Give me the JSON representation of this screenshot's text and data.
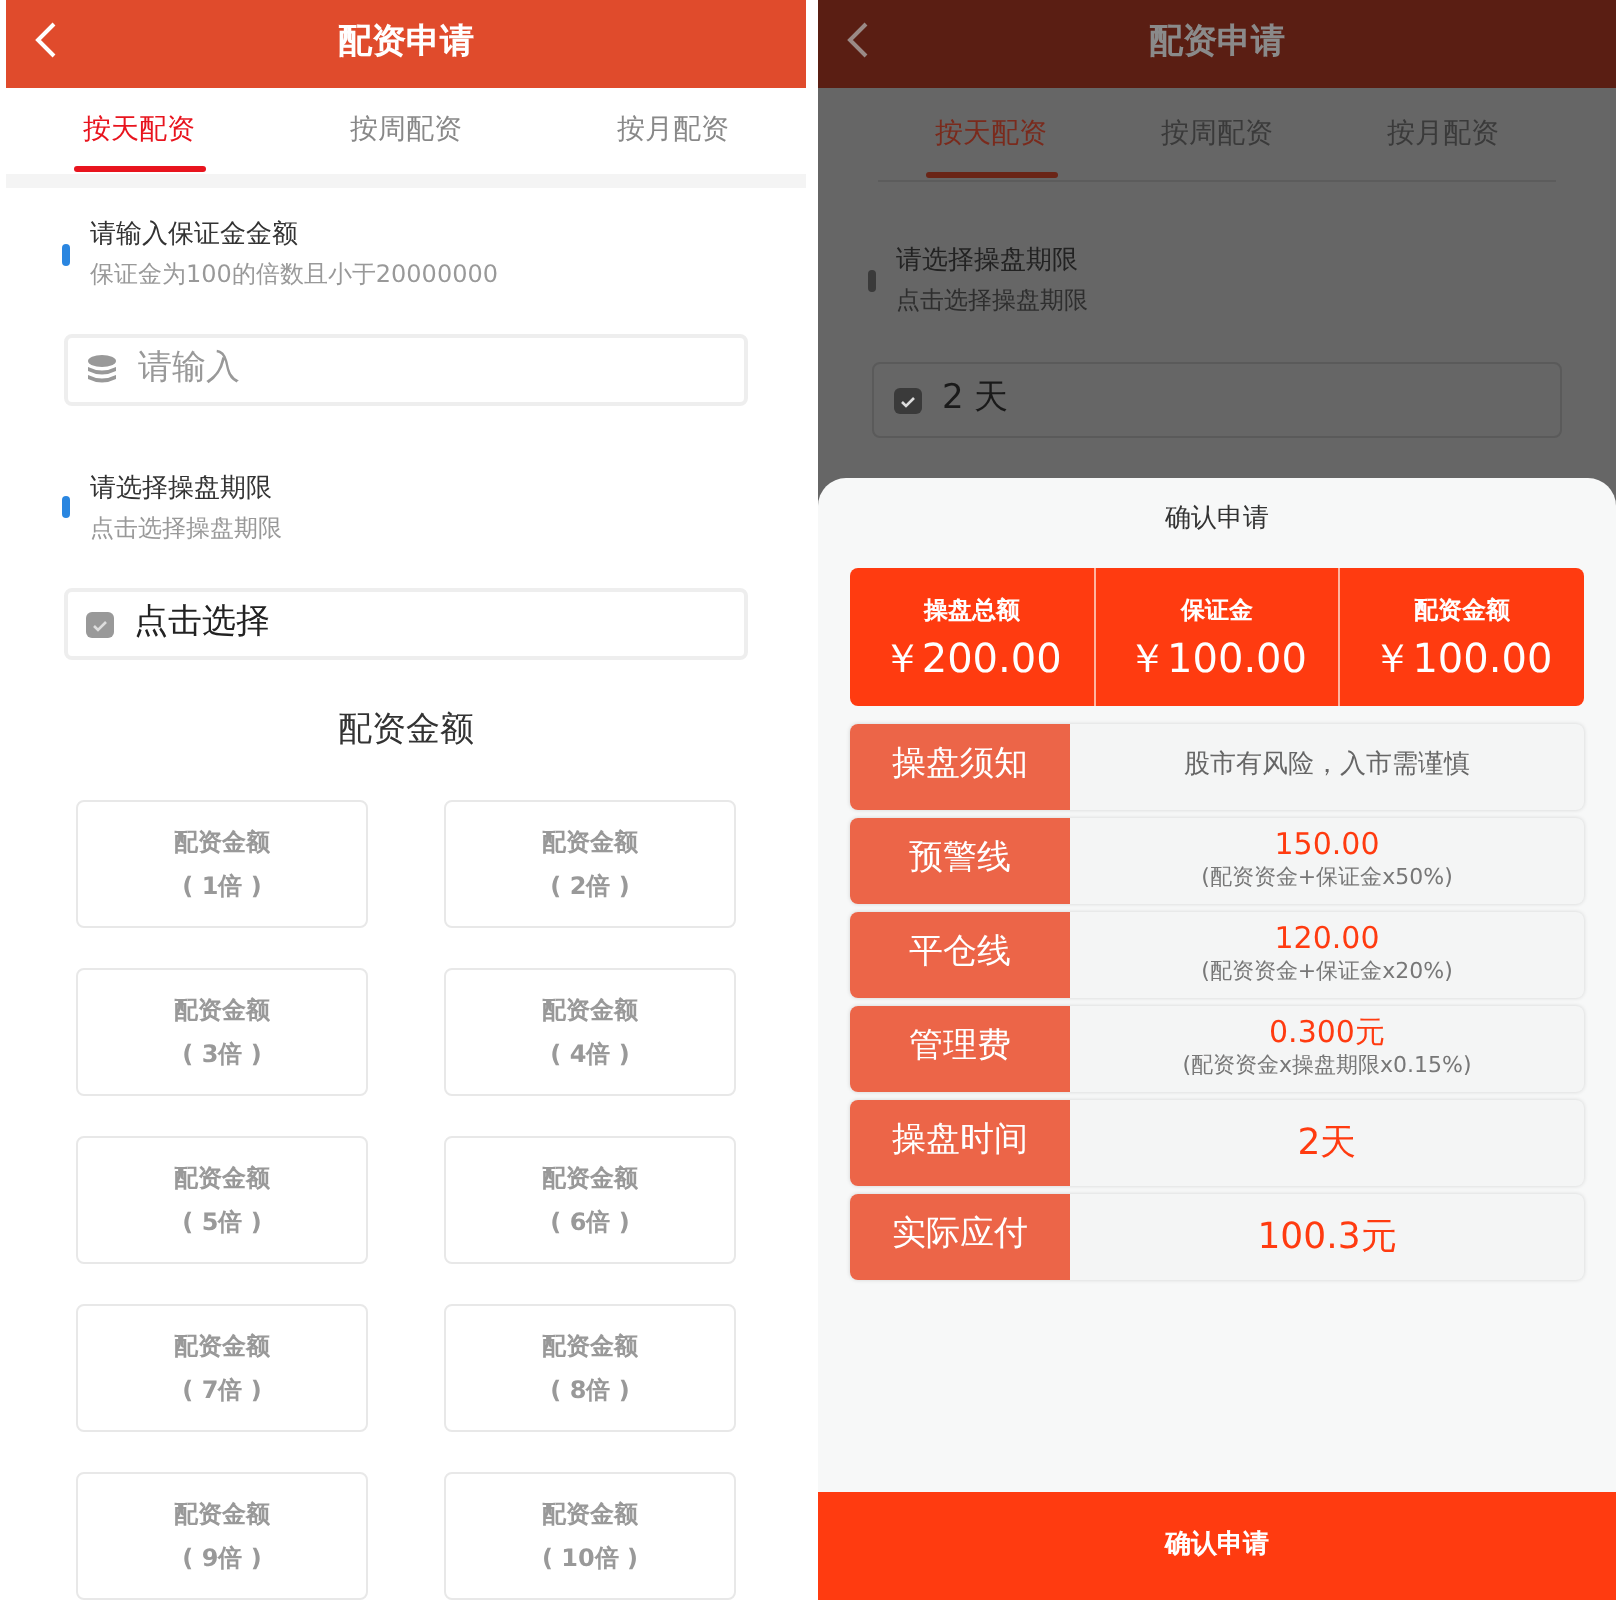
{
  "left_screen": {
    "header": {
      "title": "配资申请"
    },
    "tabs": [
      {
        "label": "按天配资",
        "selected": true
      },
      {
        "label": "按周配资",
        "selected": false
      },
      {
        "label": "按月配资",
        "selected": false
      }
    ],
    "deposit_section": {
      "label": "请输入保证金金额",
      "hint": "保证金为100的倍数且小于20000000"
    },
    "deposit_field": {
      "placeholder": "请输入"
    },
    "period_section": {
      "label": "请选择操盘期限",
      "hint": "点击选择操盘期限"
    },
    "period_field": {
      "value": "点击选择"
    },
    "amount_heading": "配资金额",
    "amount_options": [
      {
        "title": "配资金额",
        "multiple": "( 1倍 )"
      },
      {
        "title": "配资金额",
        "multiple": "( 2倍 )"
      },
      {
        "title": "配资金额",
        "multiple": "( 3倍 )"
      },
      {
        "title": "配资金额",
        "multiple": "( 4倍 )"
      },
      {
        "title": "配资金额",
        "multiple": "( 5倍 )"
      },
      {
        "title": "配资金额",
        "multiple": "( 6倍 )"
      },
      {
        "title": "配资金额",
        "multiple": "( 7倍 )"
      },
      {
        "title": "配资金额",
        "multiple": "( 8倍 )"
      },
      {
        "title": "配资金额",
        "multiple": "( 9倍 )"
      },
      {
        "title": "配资金额",
        "multiple": "( 10倍 )"
      }
    ]
  },
  "right_screen": {
    "header": {
      "title": "配资申请"
    },
    "tabs": [
      {
        "label": "按天配资",
        "selected": true
      },
      {
        "label": "按周配资",
        "selected": false
      },
      {
        "label": "按月配资",
        "selected": false
      }
    ],
    "period_section": {
      "label": "请选择操盘期限",
      "hint": "点击选择操盘期限"
    },
    "period_field": {
      "value": "2 天"
    },
    "dialog": {
      "title": "确认申请",
      "summary": [
        {
          "label": "操盘总额",
          "value": "￥200.00"
        },
        {
          "label": "保证金",
          "value": "￥100.00"
        },
        {
          "label": "配资金额",
          "value": "￥100.00"
        }
      ],
      "rows": [
        {
          "kind": "notice",
          "label": "操盘须知",
          "value": "股市有风险，入市需谨慎"
        },
        {
          "kind": "calc",
          "label": "预警线",
          "value": "150.00",
          "note": "(配资资金+保证金x50%)"
        },
        {
          "kind": "calc",
          "label": "平仓线",
          "value": "120.00",
          "note": "(配资资金+保证金x20%)"
        },
        {
          "kind": "calc",
          "label": "管理费",
          "value": "0.300元",
          "note": "(配资资金x操盘期限x0.15%)"
        },
        {
          "kind": "plain",
          "label": "操盘时间",
          "value": "2天"
        },
        {
          "kind": "plain",
          "label": "实际应付",
          "value": "100.3元"
        }
      ],
      "confirm_button": "确认申请"
    }
  }
}
